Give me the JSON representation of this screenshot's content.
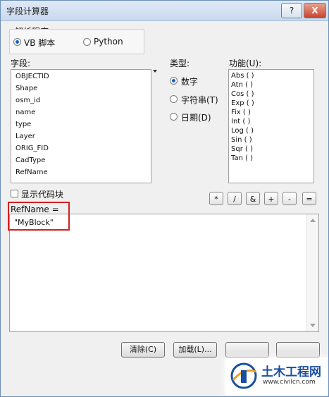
{
  "window": {
    "title": "字段计算器",
    "help_label": "?",
    "close_label": "X"
  },
  "parser": {
    "group_label": "解析程序",
    "options": [
      {
        "label": "VB 脚本",
        "selected": true
      },
      {
        "label": "Python",
        "selected": false
      }
    ]
  },
  "fields": {
    "label": "字段:",
    "items": [
      "OBJECTID",
      "Shape",
      "osm_id",
      "name",
      "type",
      "Layer",
      "ORIG_FID",
      "CadType",
      "RefName"
    ]
  },
  "types": {
    "label": "类型:",
    "options": [
      {
        "label": "数字",
        "selected": true
      },
      {
        "label": "字符串(T)",
        "selected": false
      },
      {
        "label": "日期(D)",
        "selected": false
      }
    ]
  },
  "functions": {
    "label": "功能(U):",
    "items": [
      "Abs ( )",
      "Atn ( )",
      "Cos ( )",
      "Exp ( )",
      "Fix ( )",
      "Int ( )",
      "Log ( )",
      "Sin ( )",
      "Sqr ( )",
      "Tan ( )"
    ]
  },
  "code_block": {
    "label": "显示代码块",
    "checked": false
  },
  "operators": [
    "*",
    "/",
    "&",
    "+",
    "-",
    "="
  ],
  "expression": {
    "label": "RefName =",
    "value": "\"MyBlock\""
  },
  "buttons": {
    "clear": "清除(C)",
    "load": "加载(L)..."
  },
  "watermark": {
    "name": "土木工程网",
    "url": "www.civilcn.com"
  }
}
